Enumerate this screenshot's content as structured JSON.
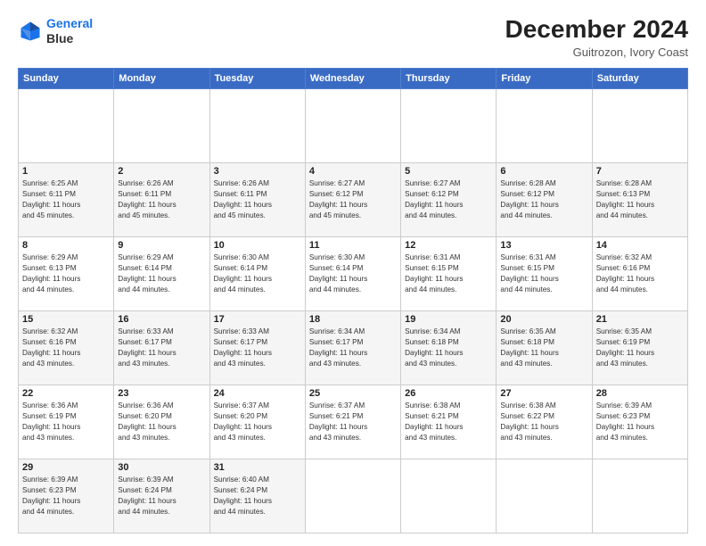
{
  "header": {
    "logo_line1": "General",
    "logo_line2": "Blue",
    "title": "December 2024",
    "subtitle": "Guitrozon, Ivory Coast"
  },
  "calendar": {
    "days_of_week": [
      "Sunday",
      "Monday",
      "Tuesday",
      "Wednesday",
      "Thursday",
      "Friday",
      "Saturday"
    ],
    "weeks": [
      [
        {
          "day": "",
          "info": ""
        },
        {
          "day": "",
          "info": ""
        },
        {
          "day": "",
          "info": ""
        },
        {
          "day": "",
          "info": ""
        },
        {
          "day": "",
          "info": ""
        },
        {
          "day": "",
          "info": ""
        },
        {
          "day": "",
          "info": ""
        }
      ],
      [
        {
          "day": "1",
          "info": "Sunrise: 6:25 AM\nSunset: 6:11 PM\nDaylight: 11 hours\nand 45 minutes."
        },
        {
          "day": "2",
          "info": "Sunrise: 6:26 AM\nSunset: 6:11 PM\nDaylight: 11 hours\nand 45 minutes."
        },
        {
          "day": "3",
          "info": "Sunrise: 6:26 AM\nSunset: 6:11 PM\nDaylight: 11 hours\nand 45 minutes."
        },
        {
          "day": "4",
          "info": "Sunrise: 6:27 AM\nSunset: 6:12 PM\nDaylight: 11 hours\nand 45 minutes."
        },
        {
          "day": "5",
          "info": "Sunrise: 6:27 AM\nSunset: 6:12 PM\nDaylight: 11 hours\nand 44 minutes."
        },
        {
          "day": "6",
          "info": "Sunrise: 6:28 AM\nSunset: 6:12 PM\nDaylight: 11 hours\nand 44 minutes."
        },
        {
          "day": "7",
          "info": "Sunrise: 6:28 AM\nSunset: 6:13 PM\nDaylight: 11 hours\nand 44 minutes."
        }
      ],
      [
        {
          "day": "8",
          "info": "Sunrise: 6:29 AM\nSunset: 6:13 PM\nDaylight: 11 hours\nand 44 minutes."
        },
        {
          "day": "9",
          "info": "Sunrise: 6:29 AM\nSunset: 6:14 PM\nDaylight: 11 hours\nand 44 minutes."
        },
        {
          "day": "10",
          "info": "Sunrise: 6:30 AM\nSunset: 6:14 PM\nDaylight: 11 hours\nand 44 minutes."
        },
        {
          "day": "11",
          "info": "Sunrise: 6:30 AM\nSunset: 6:14 PM\nDaylight: 11 hours\nand 44 minutes."
        },
        {
          "day": "12",
          "info": "Sunrise: 6:31 AM\nSunset: 6:15 PM\nDaylight: 11 hours\nand 44 minutes."
        },
        {
          "day": "13",
          "info": "Sunrise: 6:31 AM\nSunset: 6:15 PM\nDaylight: 11 hours\nand 44 minutes."
        },
        {
          "day": "14",
          "info": "Sunrise: 6:32 AM\nSunset: 6:16 PM\nDaylight: 11 hours\nand 44 minutes."
        }
      ],
      [
        {
          "day": "15",
          "info": "Sunrise: 6:32 AM\nSunset: 6:16 PM\nDaylight: 11 hours\nand 43 minutes."
        },
        {
          "day": "16",
          "info": "Sunrise: 6:33 AM\nSunset: 6:17 PM\nDaylight: 11 hours\nand 43 minutes."
        },
        {
          "day": "17",
          "info": "Sunrise: 6:33 AM\nSunset: 6:17 PM\nDaylight: 11 hours\nand 43 minutes."
        },
        {
          "day": "18",
          "info": "Sunrise: 6:34 AM\nSunset: 6:17 PM\nDaylight: 11 hours\nand 43 minutes."
        },
        {
          "day": "19",
          "info": "Sunrise: 6:34 AM\nSunset: 6:18 PM\nDaylight: 11 hours\nand 43 minutes."
        },
        {
          "day": "20",
          "info": "Sunrise: 6:35 AM\nSunset: 6:18 PM\nDaylight: 11 hours\nand 43 minutes."
        },
        {
          "day": "21",
          "info": "Sunrise: 6:35 AM\nSunset: 6:19 PM\nDaylight: 11 hours\nand 43 minutes."
        }
      ],
      [
        {
          "day": "22",
          "info": "Sunrise: 6:36 AM\nSunset: 6:19 PM\nDaylight: 11 hours\nand 43 minutes."
        },
        {
          "day": "23",
          "info": "Sunrise: 6:36 AM\nSunset: 6:20 PM\nDaylight: 11 hours\nand 43 minutes."
        },
        {
          "day": "24",
          "info": "Sunrise: 6:37 AM\nSunset: 6:20 PM\nDaylight: 11 hours\nand 43 minutes."
        },
        {
          "day": "25",
          "info": "Sunrise: 6:37 AM\nSunset: 6:21 PM\nDaylight: 11 hours\nand 43 minutes."
        },
        {
          "day": "26",
          "info": "Sunrise: 6:38 AM\nSunset: 6:21 PM\nDaylight: 11 hours\nand 43 minutes."
        },
        {
          "day": "27",
          "info": "Sunrise: 6:38 AM\nSunset: 6:22 PM\nDaylight: 11 hours\nand 43 minutes."
        },
        {
          "day": "28",
          "info": "Sunrise: 6:39 AM\nSunset: 6:23 PM\nDaylight: 11 hours\nand 43 minutes."
        }
      ],
      [
        {
          "day": "29",
          "info": "Sunrise: 6:39 AM\nSunset: 6:23 PM\nDaylight: 11 hours\nand 44 minutes."
        },
        {
          "day": "30",
          "info": "Sunrise: 6:39 AM\nSunset: 6:24 PM\nDaylight: 11 hours\nand 44 minutes."
        },
        {
          "day": "31",
          "info": "Sunrise: 6:40 AM\nSunset: 6:24 PM\nDaylight: 11 hours\nand 44 minutes."
        },
        {
          "day": "",
          "info": ""
        },
        {
          "day": "",
          "info": ""
        },
        {
          "day": "",
          "info": ""
        },
        {
          "day": "",
          "info": ""
        }
      ]
    ]
  }
}
